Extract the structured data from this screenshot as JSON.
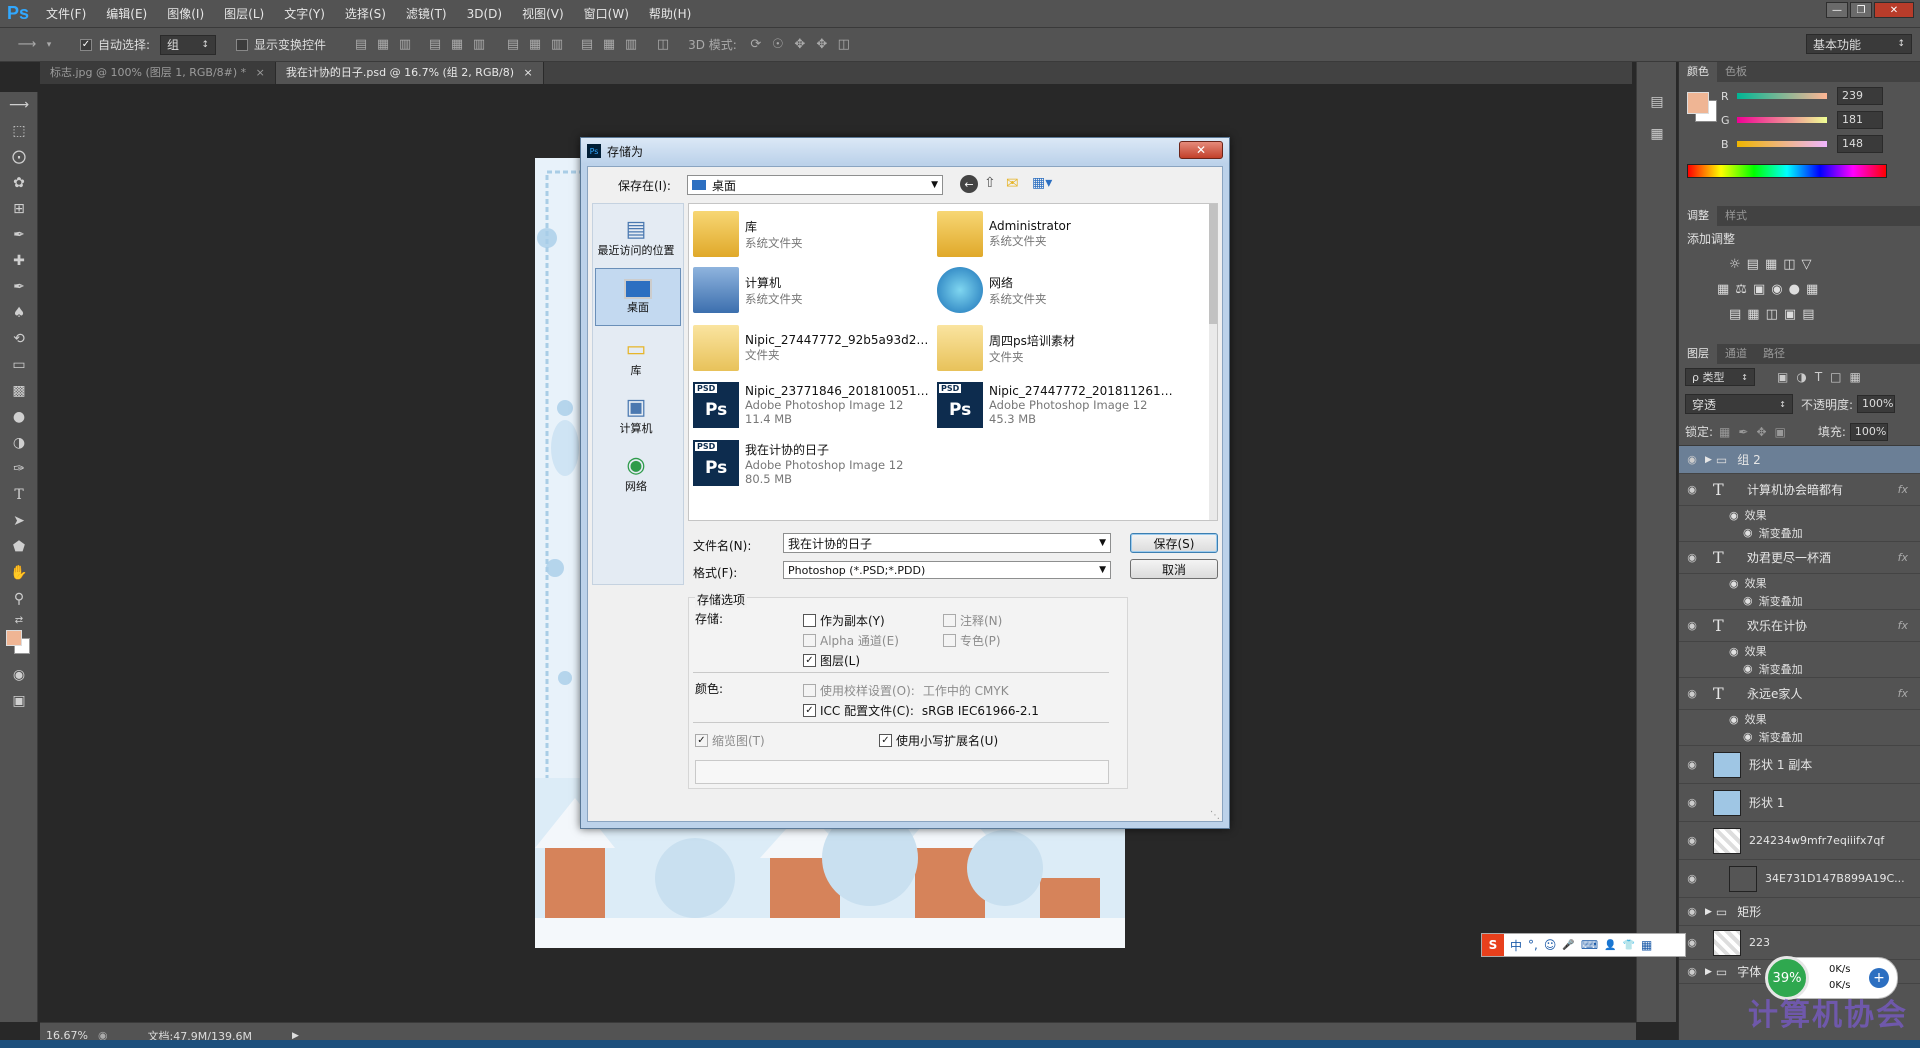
{
  "app": {
    "logo": "Ps"
  },
  "menu": [
    "文件(F)",
    "编辑(E)",
    "图像(I)",
    "图层(L)",
    "文字(Y)",
    "选择(S)",
    "滤镜(T)",
    "3D(D)",
    "视图(V)",
    "窗口(W)",
    "帮助(H)"
  ],
  "options": {
    "auto_select_label": "自动选择:",
    "auto_select_value": "组",
    "show_transform_label": "显示变换控件",
    "mode3d_label": "3D 模式:",
    "workspace": "基本功能"
  },
  "tabs": [
    {
      "label": "标志.jpg @ 100% (图层 1, RGB/8#) *",
      "close": "×"
    },
    {
      "label": "我在计协的日子.psd @ 16.7% (组 2, RGB/8)",
      "close": "×"
    }
  ],
  "status": {
    "zoom": "16.67%",
    "doc": "文档:47.9M/139.6M"
  },
  "color_panel": {
    "tabs": [
      "颜色",
      "色板"
    ],
    "r_label": "R",
    "r": "239",
    "g_label": "G",
    "g": "181",
    "b_label": "B",
    "b": "148",
    "foreground": "#efb594"
  },
  "adjust_panel": {
    "tabs": [
      "调整",
      "样式"
    ],
    "title": "添加调整"
  },
  "layers_panel": {
    "tabs": [
      "图层",
      "通道",
      "路径"
    ],
    "filter_label": "ρ 类型",
    "blend_mode": "穿透",
    "opacity_label": "不透明度:",
    "opacity": "100%",
    "lock_label": "锁定:",
    "fill_label": "填充:",
    "fill": "100%",
    "layers": [
      {
        "name": "组 2",
        "kind": "group"
      },
      {
        "name": "计算机协会暗都有",
        "kind": "text",
        "effect": "效果",
        "sub": "渐变叠加"
      },
      {
        "name": "劝君更尽一杯酒",
        "kind": "text",
        "effect": "效果",
        "sub": "渐变叠加"
      },
      {
        "name": "欢乐在计协",
        "kind": "text",
        "effect": "效果",
        "sub": "渐变叠加"
      },
      {
        "name": "永远e家人",
        "kind": "text",
        "effect": "效果",
        "sub": "渐变叠加"
      },
      {
        "name": "形状 1 副本",
        "kind": "shape"
      },
      {
        "name": "形状 1",
        "kind": "shape"
      },
      {
        "name": "224234w9mfr7eqiiifx7qf",
        "kind": "image"
      },
      {
        "name": "34E731D147B899A19C...",
        "kind": "image"
      },
      {
        "name": "矩形",
        "kind": "group"
      },
      {
        "name": "223",
        "kind": "image"
      },
      {
        "name": "字体",
        "kind": "group"
      }
    ],
    "fx": "fx"
  },
  "dialog": {
    "title": "存储为",
    "close": "✕",
    "save_in_label": "保存在(I):",
    "save_in_value": "桌面",
    "places": [
      "最近访问的位置",
      "桌面",
      "库",
      "计算机",
      "网络"
    ],
    "files": [
      {
        "name": "库",
        "sub1": "系统文件夹",
        "sub2": "",
        "icon": "library-folder"
      },
      {
        "name": "Administrator",
        "sub1": "系统文件夹",
        "sub2": "",
        "icon": "user-folder"
      },
      {
        "name": "计算机",
        "sub1": "系统文件夹",
        "sub2": "",
        "icon": "computer"
      },
      {
        "name": "网络",
        "sub1": "系统文件夹",
        "sub2": "",
        "icon": "network-globe"
      },
      {
        "name": "Nipic_27447772_92b5a93d2a...",
        "sub1": "文件夹",
        "sub2": "",
        "icon": "folder"
      },
      {
        "name": "周四ps培训素材",
        "sub1": "文件夹",
        "sub2": "",
        "icon": "folder"
      },
      {
        "name": "Nipic_23771846_2018100515...",
        "sub1": "Adobe Photoshop Image 12",
        "sub2": "11.4 MB",
        "icon": "psd-file"
      },
      {
        "name": "Nipic_27447772_2018112614...",
        "sub1": "Adobe Photoshop Image 12",
        "sub2": "45.3 MB",
        "icon": "psd-file"
      },
      {
        "name": "我在计协的日子",
        "sub1": "Adobe Photoshop Image 12",
        "sub2": "80.5 MB",
        "icon": "psd-file"
      }
    ],
    "psd_badge": "PSD",
    "ps_badge": "Ps",
    "filename_label": "文件名(N):",
    "filename_value": "我在计协的日子",
    "format_label": "格式(F):",
    "format_value": "Photoshop (*.PSD;*.PDD)",
    "save_button": "保存(S)",
    "cancel_button": "取消",
    "options_group": "存储选项",
    "storage_label": "存储:",
    "opt_copy": "作为副本(Y)",
    "opt_notes": "注释(N)",
    "opt_alpha": "Alpha 通道(E)",
    "opt_spot": "专色(P)",
    "opt_layers": "图层(L)",
    "color_label": "颜色:",
    "opt_proof": "使用校样设置(O):",
    "opt_proof_value": "工作中的 CMYK",
    "opt_icc": "ICC 配置文件(C):",
    "opt_icc_value": "sRGB IEC61966-2.1",
    "opt_thumb": "缩览图(T)",
    "opt_lowercase": "使用小写扩展名(U)"
  },
  "ime": {
    "items": [
      "中",
      "°,",
      "☺",
      "🎤",
      "⌨",
      "👤",
      "👕",
      "▦"
    ]
  },
  "net_widget": {
    "percent": "39%",
    "up": "0K/s",
    "down": "0K/s"
  },
  "watermark": "计算机协会"
}
